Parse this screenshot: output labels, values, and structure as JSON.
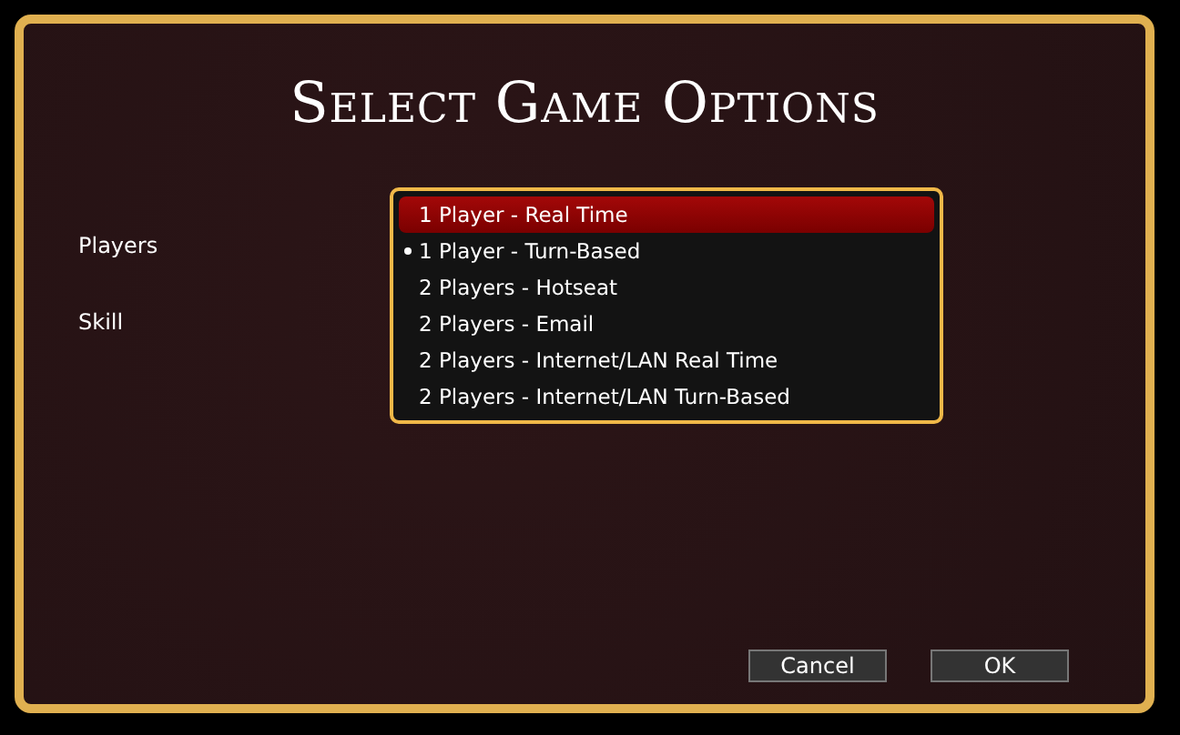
{
  "title": "Select Game Options",
  "fields": [
    {
      "label": "Players"
    },
    {
      "label": "Skill"
    }
  ],
  "players_list": [
    {
      "label": "1 Player - Real Time",
      "selected": true,
      "checked": false
    },
    {
      "label": "1 Player - Turn-Based",
      "selected": false,
      "checked": true
    },
    {
      "label": "2 Players - Hotseat",
      "selected": false,
      "checked": false
    },
    {
      "label": "2 Players - Email",
      "selected": false,
      "checked": false
    },
    {
      "label": "2 Players - Internet/LAN Real Time",
      "selected": false,
      "checked": false
    },
    {
      "label": "2 Players - Internet/LAN Turn-Based",
      "selected": false,
      "checked": false
    }
  ],
  "buttons": [
    "Cancel",
    "OK"
  ]
}
